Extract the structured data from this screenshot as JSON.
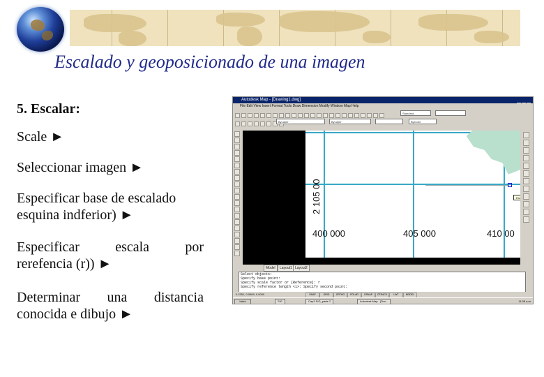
{
  "header": {
    "title": "Escalado y  geoposicionado de una imagen"
  },
  "instructions": {
    "heading": "5. Escalar:",
    "step1": "Scale ►",
    "step2": "Seleccionar imagen ►",
    "step3_line1": "Especificar base de escalado",
    "step3_line2": "esquina indferior) ►",
    "step4_w1": "Especificar",
    "step4_w2": "escala",
    "step4_w3": "por",
    "step4_line2": "rerefencia (r)) ►",
    "step5_w1": "Determinar",
    "step5_w2": "una",
    "step5_w3": "distancia",
    "step5_line2": "conocida e dibujo ►"
  },
  "screenshot": {
    "window_title": "Autodesk Map - [Drawing1.dwg]",
    "menu": "File  Edit  View  Insert  Format  Tools  Draw  Dimension  Modify  Window  Map  Help",
    "layer_combo": "ByLayer",
    "linetype_combo": "ByLayer",
    "color_combo": "ByColor",
    "style_combo": "Standard",
    "drawing": {
      "y_coordinate": "2 105 00",
      "x_labels": [
        "400 000",
        "405 000",
        "410 00"
      ],
      "tooltip": "Endpoint"
    },
    "tabs": [
      "Model",
      "Layout1",
      "Layout2"
    ],
    "command_lines": [
      "Select objects:",
      "Specify base point:",
      "Specify scale factor or [Reference]: r",
      "Specify reference length <1>:  Specify second point:"
    ],
    "status": {
      "coords": "0.2351, 0.0969, 0.0000",
      "modes": [
        "SNAP",
        "GRID",
        "ORTHO",
        "POLAR",
        "OSNAP",
        "OTRACK",
        "LWT",
        "MODEL"
      ]
    },
    "taskbar": {
      "start": "Inicio",
      "tasks": [
        "SIG",
        "Cap3 SIG_parte 2",
        "Autodesk Map - [Dra..."
      ],
      "clock": "11:05 a.m."
    }
  }
}
